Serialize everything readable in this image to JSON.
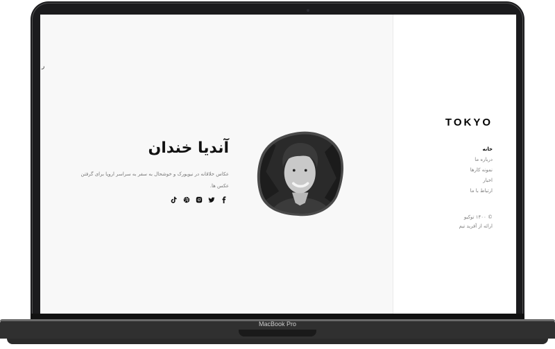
{
  "device": {
    "label": "MacBook Pro"
  },
  "sidebar": {
    "logo": "TOKYO",
    "nav": [
      {
        "label": "خانه",
        "active": true
      },
      {
        "label": "درباره ما",
        "active": false
      },
      {
        "label": "نمونه کارها",
        "active": false
      },
      {
        "label": "اخبار",
        "active": false
      },
      {
        "label": "ارتباط با ما",
        "active": false
      }
    ],
    "copyright_line1": "© ۱۴۰۰ توکیو",
    "copyright_line2": "ارائه از آفرید تیم"
  },
  "hero": {
    "name": "آندیا خندان",
    "bio": "عکاس خلاقانه در نیویورک و خوشحال به سفر به سراسر اروپا برای گرفتن عکس ها.",
    "side_mark": "ر",
    "socials": [
      "facebook-icon",
      "twitter-icon",
      "instagram-icon",
      "dribbble-icon",
      "tiktok-icon"
    ]
  }
}
